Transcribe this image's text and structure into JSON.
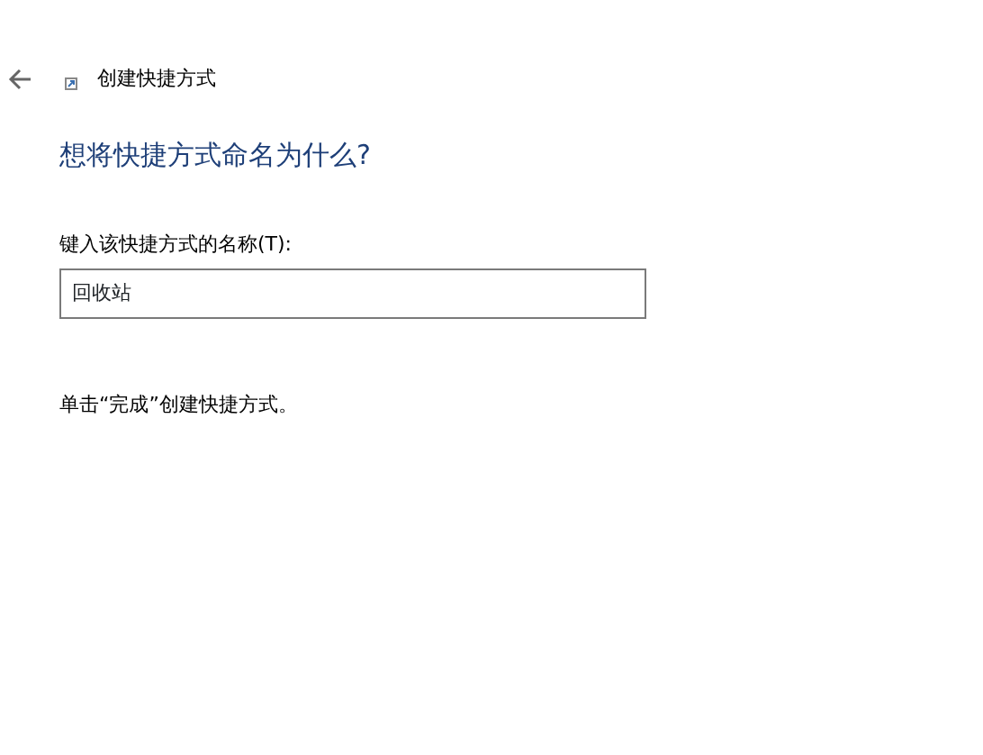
{
  "window": {
    "title": "创建快捷方式"
  },
  "heading": "想将快捷方式命名为什么?",
  "name_field": {
    "label": "键入该快捷方式的名称(T):",
    "value": "回收站"
  },
  "instruction": "单击“完成”创建快捷方式。"
}
